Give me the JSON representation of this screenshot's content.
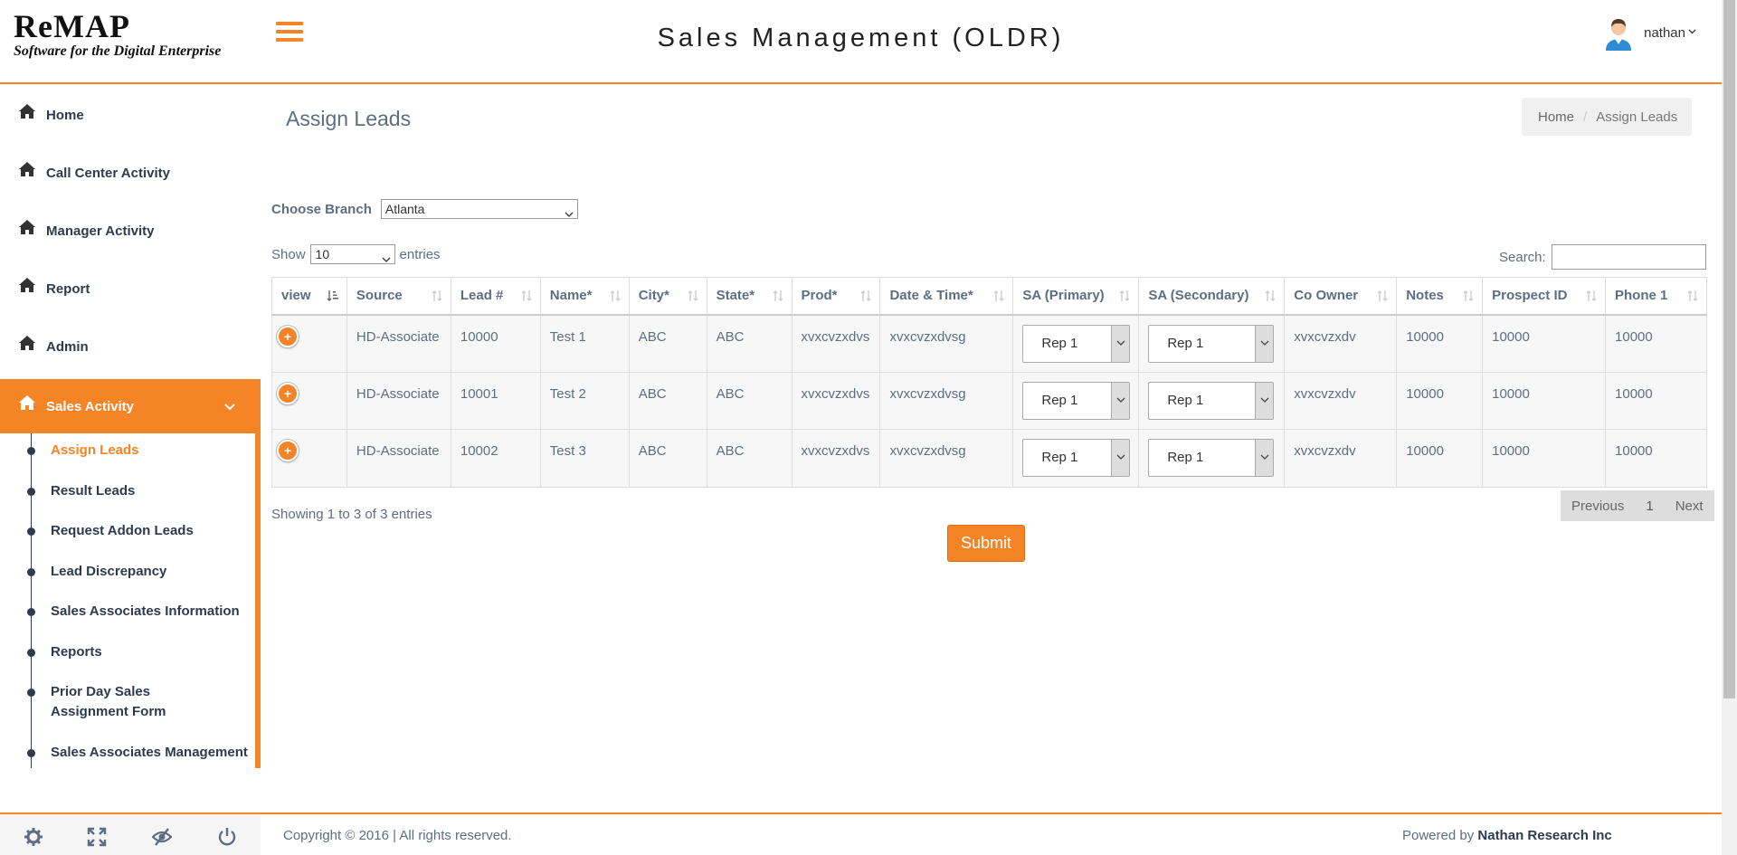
{
  "header": {
    "logo_title": "ReMAP",
    "logo_subtitle": "Software for the Digital Enterprise",
    "app_title": "Sales Management (OLDR)",
    "user_name": "nathan"
  },
  "sidebar": {
    "items": [
      {
        "label": "Home"
      },
      {
        "label": "Call Center Activity"
      },
      {
        "label": "Manager Activity"
      },
      {
        "label": "Report"
      },
      {
        "label": "Admin"
      },
      {
        "label": "Sales Activity"
      }
    ],
    "sub_items": [
      {
        "label": "Assign Leads"
      },
      {
        "label": "Result Leads"
      },
      {
        "label": "Request Addon Leads"
      },
      {
        "label": "Lead Discrepancy"
      },
      {
        "label": "Sales Associates Information"
      },
      {
        "label": "Reports"
      },
      {
        "label": "Prior Day Sales Assignment Form"
      },
      {
        "label": "Sales Associates Management"
      }
    ]
  },
  "page": {
    "title": "Assign Leads",
    "breadcrumb_home": "Home",
    "breadcrumb_current": "Assign Leads",
    "branch_label": "Choose Branch",
    "branch_value": "Atlanta",
    "show_label": "Show",
    "show_value": "10",
    "entries_label": "entries",
    "search_label": "Search:",
    "showing_text": "Showing 1 to 3 of 3 entries",
    "pager_prev": "Previous",
    "pager_page": "1",
    "pager_next": "Next",
    "submit_label": "Submit"
  },
  "table": {
    "headers": [
      "view",
      "Source",
      "Lead #",
      "Name*",
      "City*",
      "State*",
      "Prod*",
      "Date & Time*",
      "SA (Primary)",
      "SA (Secondary)",
      "Co Owner",
      "Notes",
      "Prospect ID",
      "Phone 1"
    ],
    "rows": [
      {
        "source": "HD-Associate",
        "lead": "10000",
        "name": "Test 1",
        "city": "ABC",
        "state": "ABC",
        "prod": "xvxcvzxdvs",
        "datetime": "xvxcvzxdvsg",
        "sa_primary": "Rep 1",
        "sa_secondary": "Rep 1",
        "co_owner": "xvxcvzxdv",
        "notes": "10000",
        "prospect_id": "10000",
        "phone1": "10000"
      },
      {
        "source": "HD-Associate",
        "lead": "10001",
        "name": "Test 2",
        "city": "ABC",
        "state": "ABC",
        "prod": "xvxcvzxdvs",
        "datetime": "xvxcvzxdvsg",
        "sa_primary": "Rep 1",
        "sa_secondary": "Rep 1",
        "co_owner": "xvxcvzxdv",
        "notes": "10000",
        "prospect_id": "10000",
        "phone1": "10000"
      },
      {
        "source": "HD-Associate",
        "lead": "10002",
        "name": "Test 3",
        "city": "ABC",
        "state": "ABC",
        "prod": "xvxcvzxdvs",
        "datetime": "xvxcvzxdvsg",
        "sa_primary": "Rep 1",
        "sa_secondary": "Rep 1",
        "co_owner": "xvxcvzxdv",
        "notes": "10000",
        "prospect_id": "10000",
        "phone1": "10000"
      }
    ]
  },
  "footer": {
    "copyright": "Copyright © 2016 | All rights reserved.",
    "powered_prefix": "Powered by",
    "powered_company": "Nathan Research Inc",
    "icons": [
      "gear-icon",
      "expand-icon",
      "eye-slash-icon",
      "power-icon"
    ]
  },
  "colors": {
    "accent": "#f58426",
    "text": "#5d6e82",
    "nav_text": "#2e3b4e"
  }
}
